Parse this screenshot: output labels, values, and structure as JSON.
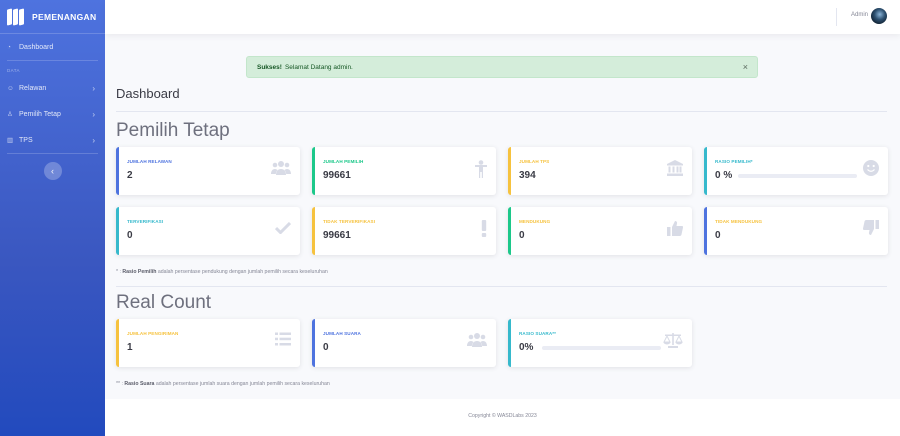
{
  "brand": {
    "name": "PEMENANGAN"
  },
  "sidebar": {
    "dashboard": "Dashboard",
    "heading": "DATA",
    "items": [
      {
        "label": "Relawan"
      },
      {
        "label": "Pemilih Tetap"
      },
      {
        "label": "TPS"
      }
    ]
  },
  "topbar": {
    "user": "Admin"
  },
  "alert": {
    "strong": "Sukses!",
    "message": "Selamat Datang admin.",
    "close": "×"
  },
  "page": {
    "title": "Dashboard"
  },
  "pemilih": {
    "title": "Pemilih Tetap",
    "cards": [
      {
        "label": "JUMLAH RELAWAN",
        "value": "2",
        "icon": "users-icon"
      },
      {
        "label": "JUMLAH PEMILIH",
        "value": "99661",
        "icon": "person-icon"
      },
      {
        "label": "JUMLAH TPS",
        "value": "394",
        "icon": "building-icon"
      },
      {
        "label": "RASIO PEMILIH*",
        "value": "0 %",
        "icon": "smile-icon",
        "progress": 0
      },
      {
        "label": "TERVERIFIKASI",
        "value": "0",
        "icon": "check-icon"
      },
      {
        "label": "TIDAK TERVERIFIKASI",
        "value": "99661",
        "icon": "exclamation-icon"
      },
      {
        "label": "MENDUKUNG",
        "value": "0",
        "icon": "thumbs-up-icon"
      },
      {
        "label": "TIDAK MENDUKUNG",
        "value": "0",
        "icon": "thumbs-down-icon"
      }
    ],
    "note_prefix": "* :",
    "note_strong": "Rasio Pemilih",
    "note_text": "adalah persentase pendukung dengan jumlah pemilih secara keseluruhan"
  },
  "realcount": {
    "title": "Real Count",
    "cards": [
      {
        "label": "JUMLAH PENGIRIMAN",
        "value": "1",
        "icon": "list-icon"
      },
      {
        "label": "JUMLAH SUARA",
        "value": "0",
        "icon": "users-icon"
      },
      {
        "label": "RASIO SUARA**",
        "value": "0%",
        "icon": "balance-scale-icon",
        "progress": 0
      }
    ],
    "note_prefix": "** :",
    "note_strong": "Rasio Suara",
    "note_text": "adalah persentase jumlah suara dengan jumlah pemilih secara keseluruhan"
  },
  "footer": {
    "text": "Copyright © WASDLabs 2023"
  },
  "colors": {
    "primary": "#4e73df",
    "success": "#1cc88a",
    "warning": "#f6c23e",
    "info": "#36b9cc"
  }
}
